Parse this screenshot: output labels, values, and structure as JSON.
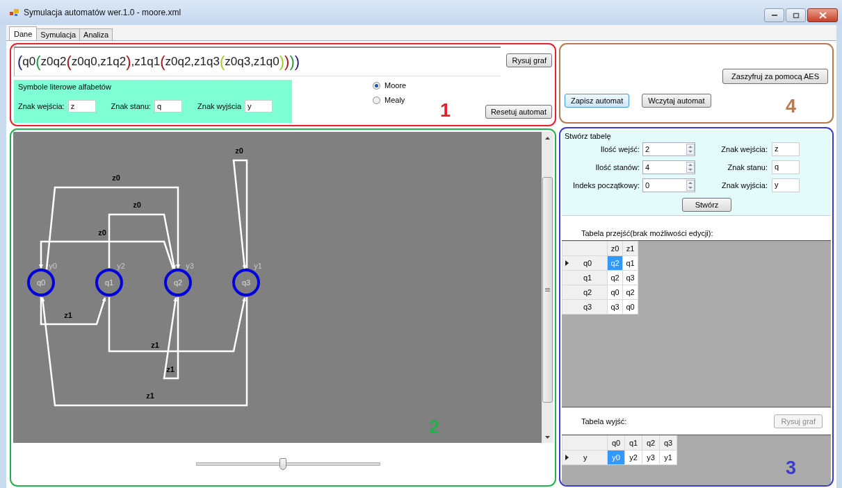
{
  "window": {
    "title": "Symulacja automatów wer.1.0 - moore.xml"
  },
  "tabs": [
    {
      "label": "Dane",
      "selected": true
    },
    {
      "label": "Symulacja",
      "selected": false
    },
    {
      "label": "Analiza",
      "selected": false
    }
  ],
  "annotations": [
    {
      "number": "1",
      "color": "#e8202a"
    },
    {
      "number": "4",
      "color": "#b87850"
    },
    {
      "number": "2",
      "color": "#22b04a"
    },
    {
      "number": "3",
      "color": "#3a3ad0"
    }
  ],
  "expression": {
    "value": "(q0(z0q2(z0q0,z1q2),z1q1(z0q2,z1q3(z0q3,z1q0))))"
  },
  "draw_button": "Rysuj graf",
  "alphabet_group": {
    "title": "Symbole literowe alfabetów",
    "fields": [
      {
        "label": "Znak wejścia:",
        "value": "z"
      },
      {
        "label": "Znak stanu:",
        "value": "q"
      },
      {
        "label": "Znak wyjścia",
        "value": "y"
      }
    ]
  },
  "automaton_type": [
    {
      "label": "Moore",
      "selected": true
    },
    {
      "label": "Mealy",
      "selected": false
    }
  ],
  "reset_button": "Resetuj automat",
  "graph": {
    "nodes": [
      {
        "name": "q0",
        "output": "y0"
      },
      {
        "name": "q1",
        "output": "y2"
      },
      {
        "name": "q2",
        "output": "y3"
      },
      {
        "name": "q3",
        "output": "y1"
      }
    ],
    "edges": [
      {
        "label": "z0"
      },
      {
        "label": "z0"
      },
      {
        "label": "z0"
      },
      {
        "label": "z0"
      },
      {
        "label": "z1"
      },
      {
        "label": "z1"
      },
      {
        "label": "z1"
      },
      {
        "label": "z1"
      }
    ]
  },
  "zoom_slider": {
    "level": 0.47
  },
  "file_panel": {
    "encrypt_button": "Zaszyfruj za pomocą AES",
    "save_button": "Zapisz automat",
    "load_button": "Wczytaj automat"
  },
  "create_table": {
    "title": "Stwórz tabelę",
    "spinners": [
      {
        "label": "Ilość wejść:",
        "value": "2"
      },
      {
        "label": "Ilość stanów:",
        "value": "4"
      },
      {
        "label": "Indeks początkowy:",
        "value": "0"
      }
    ],
    "fields": [
      {
        "label": "Znak wejścia:",
        "value": "z"
      },
      {
        "label": "Znak stanu:",
        "value": "q"
      },
      {
        "label": "Znak wyjścia:",
        "value": "y"
      }
    ],
    "create_button": "Stwórz"
  },
  "transition_table": {
    "caption": "Tabela przejść(brak możliwości edycji):",
    "columns": [
      "z0",
      "z1"
    ],
    "rows": [
      {
        "header": "q0",
        "current": true,
        "cells": [
          {
            "text": "q2",
            "selected": true
          },
          {
            "text": "q1",
            "selected": false
          }
        ]
      },
      {
        "header": "q1",
        "current": false,
        "cells": [
          {
            "text": "q2",
            "selected": false
          },
          {
            "text": "q3",
            "selected": false
          }
        ]
      },
      {
        "header": "q2",
        "current": false,
        "cells": [
          {
            "text": "q0",
            "selected": false
          },
          {
            "text": "q2",
            "selected": false
          }
        ]
      },
      {
        "header": "q3",
        "current": false,
        "cells": [
          {
            "text": "q3",
            "selected": false
          },
          {
            "text": "q0",
            "selected": false
          }
        ]
      }
    ]
  },
  "output_table": {
    "caption": "Tabela wyjść:",
    "button": {
      "label": "Rysuj graf",
      "disabled": true
    },
    "columns": [
      "q0",
      "q1",
      "q2",
      "q3"
    ],
    "rows": [
      {
        "header": "y",
        "current": true,
        "cells": [
          {
            "text": "y0",
            "selected": true
          },
          {
            "text": "y2",
            "selected": false
          },
          {
            "text": "y3",
            "selected": false
          },
          {
            "text": "y1",
            "selected": false
          }
        ]
      }
    ]
  }
}
